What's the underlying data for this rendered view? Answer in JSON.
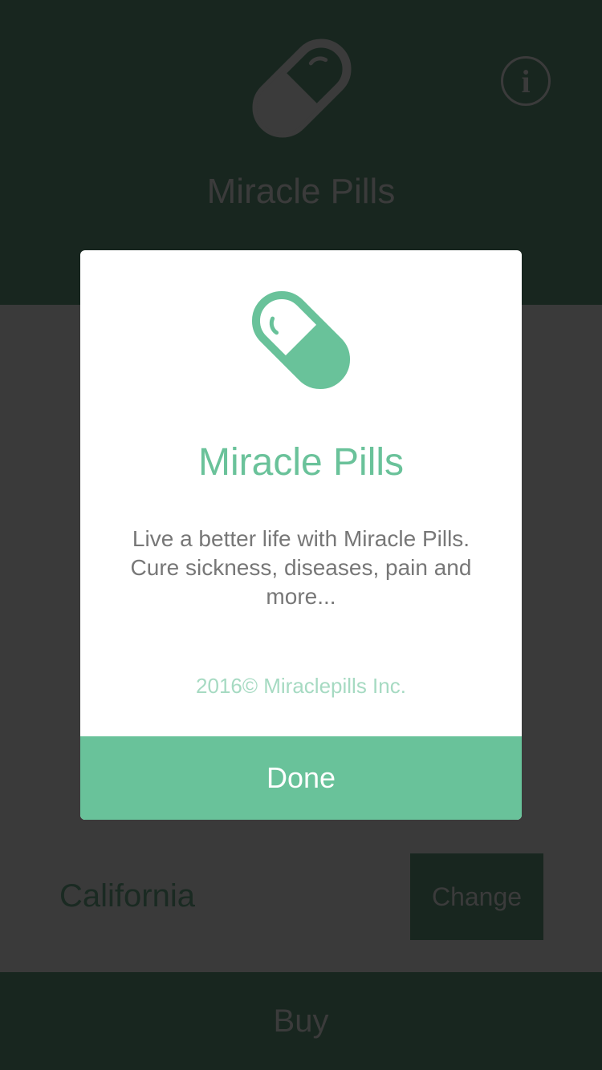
{
  "header": {
    "title": "Miracle Pills",
    "info_icon": "info-circle-icon",
    "pill_icon": "pill-capsule-icon"
  },
  "main": {
    "state": "California",
    "change_label": "Change",
    "buy_label": "Buy"
  },
  "modal": {
    "pill_icon": "pill-capsule-icon",
    "title": "Miracle Pills",
    "description": "Live a better life with Miracle Pills. Cure sickness, diseases, pain and more...",
    "copyright": "2016© Miraclepills Inc.",
    "done_label": "Done"
  },
  "colors": {
    "accent": "#69c29a",
    "dark_header": "#18261f",
    "overlay_gray": "#3a3a3a"
  }
}
